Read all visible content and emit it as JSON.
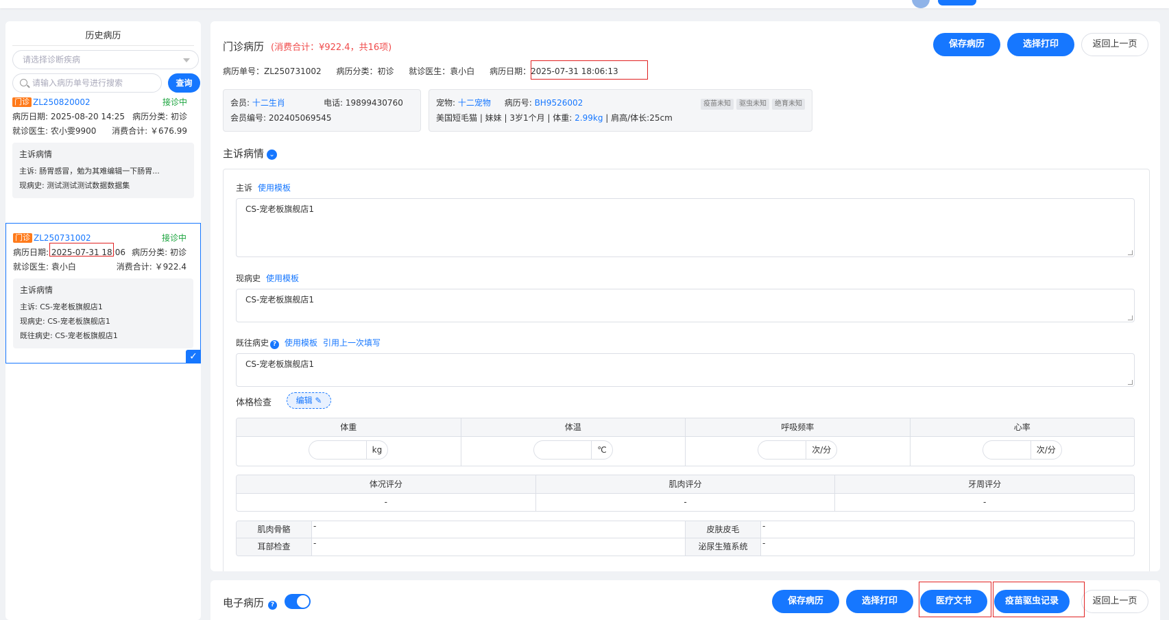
{
  "sidebar": {
    "title": "历史病历",
    "diagnosis_placeholder": "请选择诊断疾病",
    "search_placeholder": "请输入病历单号进行搜索",
    "query_label": "查询",
    "records": [
      {
        "tag": "门诊",
        "id": "ZL250820002",
        "status": "接诊中",
        "date_label": "病历日期: 2025-08-20 14:25",
        "category_label": "病历分类: 初诊",
        "doctor_label": "就诊医生: 农小雯9900",
        "fee_label": "消费合计: ￥676.99",
        "detail_title": "主诉病情",
        "lines": [
          "主诉:   肠胃感冒，勉为其难编辑一下肠胃...",
          "现病史:   测试测试测试数据数据集"
        ]
      },
      {
        "tag": "门诊",
        "id": "ZL250731002",
        "status": "接诊中",
        "date_label": "病历日期: 2025-07-31 18:06",
        "category_label": "病历分类: 初诊",
        "doctor_label": "就诊医生: 袁小白",
        "fee_label": "消费合计: ￥922.4",
        "detail_title": "主诉病情",
        "lines": [
          "主诉:   CS-宠老板旗舰店1",
          "现病史:   CS-宠老板旗舰店1",
          "既往病史:   CS-宠老板旗舰店1"
        ]
      }
    ]
  },
  "main": {
    "title": "门诊病历",
    "fee_summary": "(消费合计：¥922.4，共16项)",
    "buttons": {
      "save": "保存病历",
      "print": "选择打印",
      "back": "返回上一页"
    },
    "info": {
      "record_no": "病历单号：ZL250731002",
      "category": "病历分类：初诊",
      "doctor": "就诊医生：袁小白",
      "date": "病历日期：2025-07-31 18:06:13"
    },
    "member_card": {
      "member_label": "会员: ",
      "member_name": "十二生肖",
      "phone": "电话: 19899430760",
      "member_no": "会员编号: 202405069545"
    },
    "pet_card": {
      "pet_label": "宠物: ",
      "pet_name": "十二宠物",
      "record_label": "病历号: ",
      "record_no": "BH9526002",
      "tags": [
        "疫苗未知",
        "驱虫未知",
        "绝育未知"
      ],
      "desc_prefix": "美国短毛猫  |  妹妹  |  3岁1个月  |  体重: ",
      "weight": "2.99kg",
      "desc_suffix": "  |  肩高/体长:25cm"
    },
    "section_title": "主诉病情",
    "fields": {
      "complaint_label": "主诉",
      "history_label": "现病史",
      "past_label": "既往病史",
      "template_link": "使用模板",
      "quote_link": "引用上一次填写",
      "complaint_value": "CS-宠老板旗舰店1",
      "history_value": "CS-宠老板旗舰店1",
      "past_value": "CS-宠老板旗舰店1"
    },
    "exam": {
      "title": "体格检查",
      "edit_label": "编辑 ✎",
      "vitals": [
        {
          "label": "体重",
          "unit": "kg"
        },
        {
          "label": "体温",
          "unit": "℃"
        },
        {
          "label": "呼吸频率",
          "unit": "次/分"
        },
        {
          "label": "心率",
          "unit": "次/分"
        }
      ],
      "scores": [
        {
          "label": "体况评分",
          "value": "-"
        },
        {
          "label": "肌肉评分",
          "value": "-"
        },
        {
          "label": "牙周评分",
          "value": "-"
        }
      ],
      "systems": [
        {
          "k1": "肌肉骨骼",
          "v1": "-",
          "k2": "皮肤皮毛",
          "v2": "-"
        },
        {
          "k1": "耳部检查",
          "v1": "-",
          "k2": "泌尿生殖系统",
          "v2": "-"
        }
      ]
    }
  },
  "bottom": {
    "title": "电子病历",
    "buttons": {
      "save": "保存病历",
      "print": "选择打印",
      "medical_doc": "医疗文书",
      "vaccine": "疫苗驱虫记录",
      "back": "返回上一页"
    }
  },
  "colors": {
    "primary": "#1677ff",
    "accent_red": "#f04b4b",
    "status_green": "#19a33c",
    "tag_orange": "#ff7a1a"
  }
}
